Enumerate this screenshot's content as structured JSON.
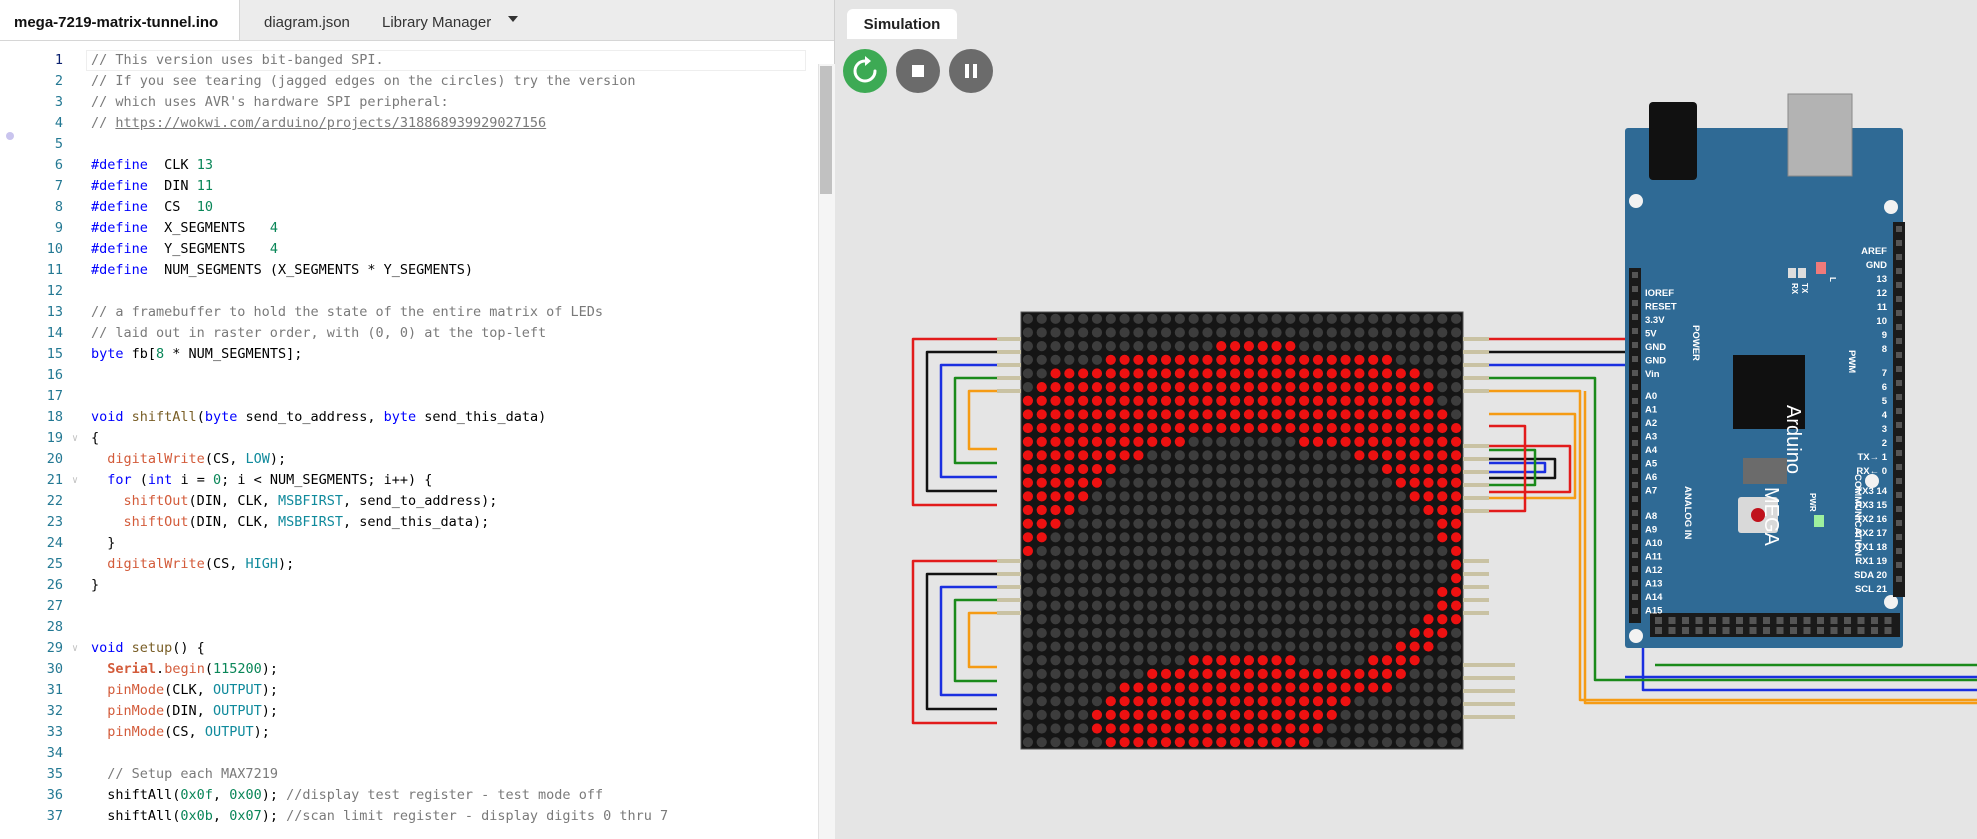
{
  "editor": {
    "tabs": [
      {
        "label": "mega-7219-matrix-tunnel.ino"
      },
      {
        "label": "diagram.json"
      },
      {
        "label": "Library Manager"
      }
    ],
    "current_line": 1,
    "lines": [
      [
        [
          "c-com",
          "// This version uses bit-banged SPI."
        ]
      ],
      [
        [
          "c-com",
          "// If you see tearing (jagged edges on the circles) try the version"
        ]
      ],
      [
        [
          "c-com",
          "// which uses AVR's hardware SPI peripheral:"
        ]
      ],
      [
        [
          "c-com",
          "// "
        ],
        [
          "c-link",
          "https://wokwi.com/arduino/projects/318868939929027156"
        ]
      ],
      [],
      [
        [
          "c-dir",
          "#define"
        ],
        [
          "",
          "  CLK "
        ],
        [
          "c-num",
          "13"
        ]
      ],
      [
        [
          "c-dir",
          "#define"
        ],
        [
          "",
          "  DIN "
        ],
        [
          "c-num",
          "11"
        ]
      ],
      [
        [
          "c-dir",
          "#define"
        ],
        [
          "",
          "  CS  "
        ],
        [
          "c-num",
          "10"
        ]
      ],
      [
        [
          "c-dir",
          "#define"
        ],
        [
          "",
          "  X_SEGMENTS   "
        ],
        [
          "c-num",
          "4"
        ]
      ],
      [
        [
          "c-dir",
          "#define"
        ],
        [
          "",
          "  Y_SEGMENTS   "
        ],
        [
          "c-num",
          "4"
        ]
      ],
      [
        [
          "c-dir",
          "#define"
        ],
        [
          "",
          "  NUM_SEGMENTS (X_SEGMENTS * Y_SEGMENTS)"
        ]
      ],
      [],
      [
        [
          "c-com",
          "// a framebuffer to hold the state of the entire matrix of LEDs"
        ]
      ],
      [
        [
          "c-com",
          "// laid out in raster order, with (0, 0) at the top-left"
        ]
      ],
      [
        [
          "c-typ",
          "byte"
        ],
        [
          "",
          " fb["
        ],
        [
          "c-num",
          "8"
        ],
        [
          "",
          " * NUM_SEGMENTS];"
        ]
      ],
      [],
      [],
      [
        [
          "c-kw",
          "void"
        ],
        [
          "",
          " "
        ],
        [
          "c-fn",
          "shiftAll"
        ],
        [
          "",
          "("
        ],
        [
          "c-typ",
          "byte"
        ],
        [
          "",
          " send_to_address, "
        ],
        [
          "c-typ",
          "byte"
        ],
        [
          "",
          " send_this_data)"
        ]
      ],
      [
        [
          "",
          "{"
        ]
      ],
      [
        [
          "",
          "  "
        ],
        [
          "c-ard",
          "digitalWrite"
        ],
        [
          "",
          "(CS, "
        ],
        [
          "c-const",
          "LOW"
        ],
        [
          "",
          ");"
        ]
      ],
      [
        [
          "",
          "  "
        ],
        [
          "c-kw",
          "for"
        ],
        [
          "",
          " ("
        ],
        [
          "c-typ",
          "int"
        ],
        [
          "",
          " i = "
        ],
        [
          "c-num",
          "0"
        ],
        [
          "",
          "; i < NUM_SEGMENTS; i++) {"
        ]
      ],
      [
        [
          "",
          "    "
        ],
        [
          "c-ard",
          "shiftOut"
        ],
        [
          "",
          "(DIN, CLK, "
        ],
        [
          "c-const",
          "MSBFIRST"
        ],
        [
          "",
          ", send_to_address);"
        ]
      ],
      [
        [
          "",
          "    "
        ],
        [
          "c-ard",
          "shiftOut"
        ],
        [
          "",
          "(DIN, CLK, "
        ],
        [
          "c-const",
          "MSBFIRST"
        ],
        [
          "",
          ", send_this_data);"
        ]
      ],
      [
        [
          "",
          "  }"
        ]
      ],
      [
        [
          "",
          "  "
        ],
        [
          "c-ard",
          "digitalWrite"
        ],
        [
          "",
          "(CS, "
        ],
        [
          "c-const",
          "HIGH"
        ],
        [
          "",
          ");"
        ]
      ],
      [
        [
          "",
          "}"
        ]
      ],
      [],
      [],
      [
        [
          "c-kw",
          "void"
        ],
        [
          "",
          " "
        ],
        [
          "c-fn",
          "setup"
        ],
        [
          "",
          "() {"
        ]
      ],
      [
        [
          "",
          "  "
        ],
        [
          "c-obj",
          "Serial"
        ],
        [
          "",
          "."
        ],
        [
          "c-ard",
          "begin"
        ],
        [
          "",
          "("
        ],
        [
          "c-num",
          "115200"
        ],
        [
          "",
          ");"
        ]
      ],
      [
        [
          "",
          "  "
        ],
        [
          "c-ard",
          "pinMode"
        ],
        [
          "",
          "(CLK, "
        ],
        [
          "c-const",
          "OUTPUT"
        ],
        [
          "",
          ");"
        ]
      ],
      [
        [
          "",
          "  "
        ],
        [
          "c-ard",
          "pinMode"
        ],
        [
          "",
          "(DIN, "
        ],
        [
          "c-const",
          "OUTPUT"
        ],
        [
          "",
          ");"
        ]
      ],
      [
        [
          "",
          "  "
        ],
        [
          "c-ard",
          "pinMode"
        ],
        [
          "",
          "(CS, "
        ],
        [
          "c-const",
          "OUTPUT"
        ],
        [
          "",
          ");"
        ]
      ],
      [],
      [
        [
          "",
          "  "
        ],
        [
          "c-com",
          "// Setup each MAX7219"
        ]
      ],
      [
        [
          "",
          "  shiftAll("
        ],
        [
          "c-num",
          "0x0f"
        ],
        [
          "",
          ", "
        ],
        [
          "c-num",
          "0x00"
        ],
        [
          "",
          "); "
        ],
        [
          "c-com",
          "//display test register - test mode off"
        ]
      ],
      [
        [
          "",
          "  shiftAll("
        ],
        [
          "c-num",
          "0x0b"
        ],
        [
          "",
          ", "
        ],
        [
          "c-num",
          "0x07"
        ],
        [
          "",
          "); "
        ],
        [
          "c-com",
          "//scan limit register - display digits 0 thru 7"
        ]
      ]
    ]
  },
  "simulation": {
    "tab_label": "Simulation",
    "controls": {
      "restart": "restart-icon",
      "stop": "stop-icon",
      "pause": "pause-icon"
    },
    "board": {
      "name_line1": "Arduino",
      "name_line2": "MEGA",
      "power_left": [
        "IOREF",
        "RESET",
        "3.3V",
        "5V",
        "GND",
        "GND",
        "Vin"
      ],
      "power_title": "POWER",
      "analog_left": [
        "A0",
        "A1",
        "A2",
        "A3",
        "A4",
        "A5",
        "A6",
        "A7",
        "A8",
        "A9",
        "A10",
        "A11",
        "A12",
        "A13",
        "A14",
        "A15"
      ],
      "analog_title": "ANALOG IN",
      "digital_top": [
        "AREF",
        "GND",
        "13",
        "12",
        "11",
        "10",
        "9",
        "8"
      ],
      "pwm_title": "PWM",
      "digital_mid": [
        "7",
        "6",
        "5",
        "4",
        "3",
        "2",
        "TX→ 1",
        "RX← 0"
      ],
      "comm_right": [
        "TX3 14",
        "RX3 15",
        "TX2 16",
        "RX2 17",
        "TX1 18",
        "RX1 19",
        "SDA 20",
        "SCL 21"
      ],
      "comm_title": "COMMUNICATION",
      "led_labels": [
        "RX",
        "TX",
        "L"
      ],
      "pwr_led": "PWR"
    },
    "matrix": {
      "cols": 32,
      "rows": 32,
      "on_color": "#ee1111",
      "off_color": "#3d3d3d",
      "body_color": "#151515",
      "pattern": [
        "00000000000000000000000000000000",
        "00000000000000000000000000000000",
        "00000000000000111111000000000000",
        "00000011111111111111111111100000",
        "00111111111111111111111111111000",
        "01111111111111111111111111111100",
        "11111111111111111111111111111100",
        "11111111111111111111111111111110",
        "11111111111111111111111111111111",
        "11111111111100000000111111111111",
        "11111111100000000000000011111111",
        "11111110000000000000000000111111",
        "11111100000000000000000000011111",
        "11111000000000000000000000001111",
        "11110000000000000000000000000111",
        "11100000000000000000000000000011",
        "11000000000000000000000000000011",
        "10000000000000000000000000000001",
        "00000000000000000000000000000001",
        "00000000000000000000000000000001",
        "00000000000000000000000000000011",
        "00000000000000000000000000000011",
        "00000000000000000000000000000111",
        "00000000000000000000000000001110",
        "00000000000000000000000000011100",
        "00000000000011111111000001111000",
        "00000000011111111111111111110000",
        "00000001111111111111111111100000",
        "00000011111111111111111100000000",
        "00000111111111111111111000000000",
        "00000111111111111111110000000000",
        "00000011111111111111100000000000"
      ]
    },
    "wire_colors": {
      "red": "#e21b1b",
      "black": "#111111",
      "blue": "#1a2fe0",
      "green": "#1a8a1a",
      "orange": "#f59b14"
    }
  }
}
